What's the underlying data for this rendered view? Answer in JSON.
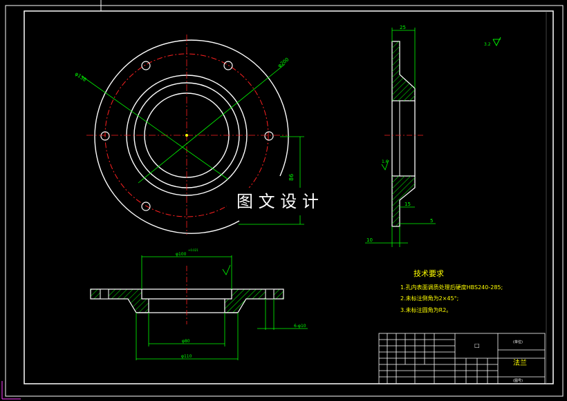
{
  "watermark": "图 文 设 计",
  "roughness_symbol": "3.2",
  "section_roughness": "1.6",
  "front_view": {
    "dim_bolt_circle": "φ138",
    "dim_outer": "φ200",
    "dim_height": "86"
  },
  "side_view": {
    "dim_top": "25",
    "dim_step": "15",
    "dim_edge": "5",
    "dim_bottom": "10"
  },
  "section_view": {
    "dim_bore": "φ100",
    "dim_bore_tol": "+0.021",
    "dim_inner": "φ80",
    "dim_base": "φ110",
    "dim_holes": "6-φ10"
  },
  "tech_requirements": {
    "title": "技术要求",
    "items": [
      "1.孔内表面调质处理后硬度HBS240-285;",
      "2.未标注倒角为2×45°;",
      "3.未标注圆角为R2。"
    ]
  },
  "title_block": {
    "material_cell": "□",
    "part_name": "法兰",
    "company_cell": "(单位)",
    "drawing_no": "(图号)"
  },
  "colors": {
    "outline": "#ffffff",
    "centerline": "#ff2020",
    "dimension": "#00ff00",
    "hatch": "#00ff00",
    "text": "#ffff00",
    "border": "#ffffff"
  }
}
